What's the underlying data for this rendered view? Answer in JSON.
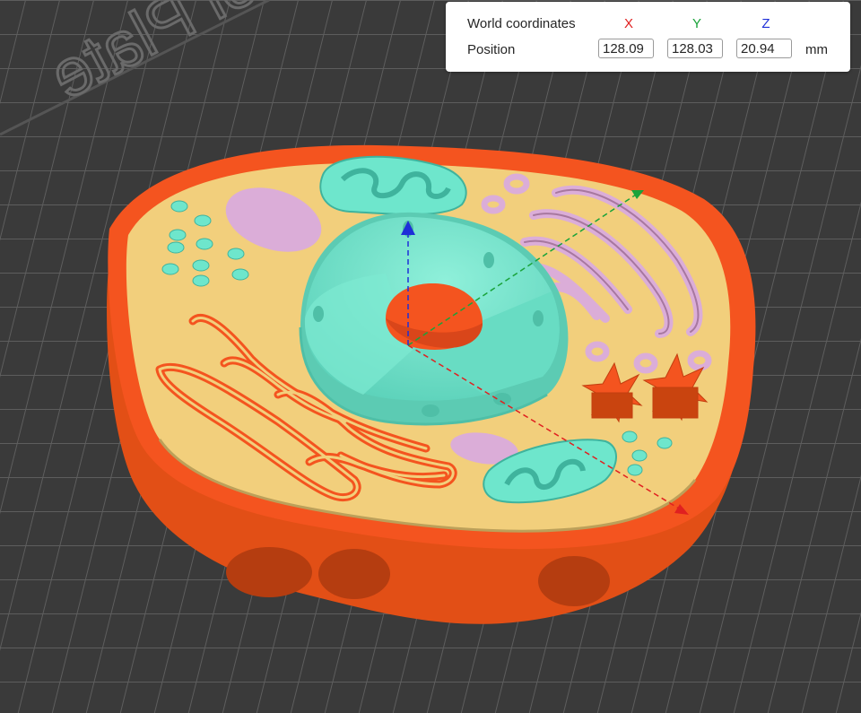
{
  "coordinates_panel": {
    "title": "World coordinates",
    "axes": [
      {
        "label": "X",
        "color": "#e02020"
      },
      {
        "label": "Y",
        "color": "#1aa33a"
      },
      {
        "label": "Z",
        "color": "#1e2fd8"
      }
    ],
    "row_label": "Position",
    "position": {
      "x": "128.09",
      "y": "128.03",
      "z": "20.94"
    },
    "unit": "mm"
  },
  "build_plate": {
    "engraved_text": "Cool Plate",
    "colors": {
      "plate": "#3a3a3a",
      "grid": "#5e5e5e"
    }
  },
  "model": {
    "colors": {
      "membrane": "#f4541f",
      "cytoplasm": "#f2cf7c",
      "nucleus": "#6ee6cc",
      "nucleolus": "#f4541f",
      "lysosome": "#dbadd8",
      "golgi": "#dbadd8",
      "er": "#f4541f",
      "mitochondria": "#6ee6cc"
    }
  },
  "gizmo": {
    "x_color": "#e02020",
    "y_color": "#1aa33a",
    "z_color": "#1e2fd8"
  }
}
